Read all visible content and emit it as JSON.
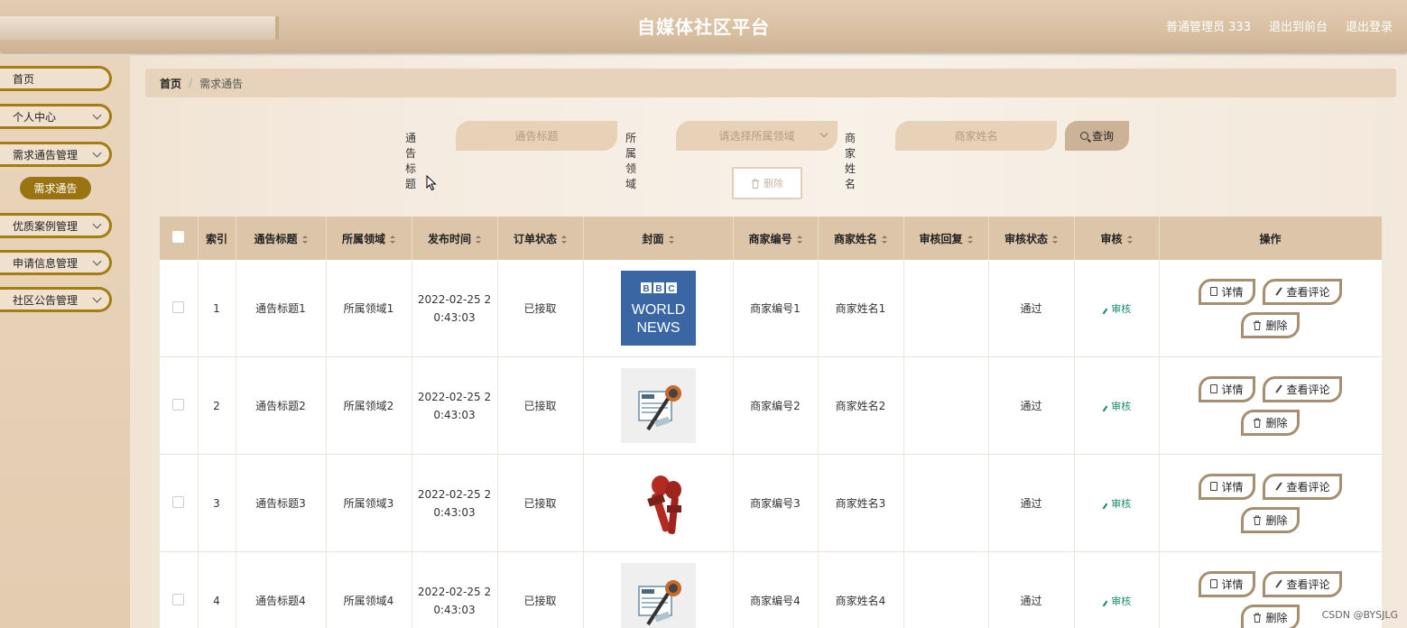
{
  "header": {
    "title": "自媒体社区平台",
    "user": "普通管理员 333",
    "back_front": "退出到前台",
    "logout": "退出登录"
  },
  "sidebar": {
    "items": [
      {
        "label": "首页",
        "has_arrow": false
      },
      {
        "label": "个人中心",
        "has_arrow": true
      },
      {
        "label": "需求通告管理",
        "has_arrow": true
      },
      {
        "label": "优质案例管理",
        "has_arrow": true
      },
      {
        "label": "申请信息管理",
        "has_arrow": true
      },
      {
        "label": "社区公告管理",
        "has_arrow": true
      }
    ],
    "active_sub": "需求通告"
  },
  "breadcrumb": {
    "home": "首页",
    "sep": "/",
    "current": "需求通告"
  },
  "search": {
    "title_label": "通告标题",
    "title_placeholder": "通告标题",
    "field_label": "所属领域",
    "field_placeholder": "请选择所属领域",
    "merchant_label": "商家姓名",
    "merchant_placeholder": "商家姓名",
    "query_label": "查询"
  },
  "toolbar": {
    "delete_label": "删除"
  },
  "table": {
    "headers": [
      "索引",
      "通告标题",
      "所属领域",
      "发布时间",
      "订单状态",
      "封面",
      "商家编号",
      "商家姓名",
      "审核回复",
      "审核状态",
      "审核",
      "操作"
    ],
    "rows": [
      {
        "index": "1",
        "title": "通告标题1",
        "field": "所属领域1",
        "date_a": "2022-02-25 2",
        "date_b": "0:43:03",
        "order": "已接取",
        "cover": "bbc-world-news",
        "mno": "商家编号1",
        "mname": "商家姓名1",
        "reply": "",
        "status": "通过",
        "audit": "审核"
      },
      {
        "index": "2",
        "title": "通告标题2",
        "field": "所属领域2",
        "date_a": "2022-02-25 2",
        "date_b": "0:43:03",
        "order": "已接取",
        "cover": "news-microphone",
        "mno": "商家编号2",
        "mname": "商家姓名2",
        "reply": "",
        "status": "通过",
        "audit": "审核"
      },
      {
        "index": "3",
        "title": "通告标题3",
        "field": "所属领域3",
        "date_a": "2022-02-25 2",
        "date_b": "0:43:03",
        "order": "已接取",
        "cover": "red-microphones",
        "mno": "商家编号3",
        "mname": "商家姓名3",
        "reply": "",
        "status": "通过",
        "audit": "审核"
      },
      {
        "index": "4",
        "title": "通告标题4",
        "field": "所属领域4",
        "date_a": "2022-02-25 2",
        "date_b": "0:43:03",
        "order": "已接取",
        "cover": "news-microphone",
        "mno": "商家编号4",
        "mname": "商家姓名4",
        "reply": "",
        "status": "通过",
        "audit": "审核"
      }
    ],
    "actions": {
      "detail": "详情",
      "comments": "查看评论",
      "delete": "删除"
    }
  },
  "cover_text": {
    "bbc": "BBC",
    "world": "WORLD",
    "news": "NEWS"
  },
  "watermark": "CSDN @BYSJLG"
}
